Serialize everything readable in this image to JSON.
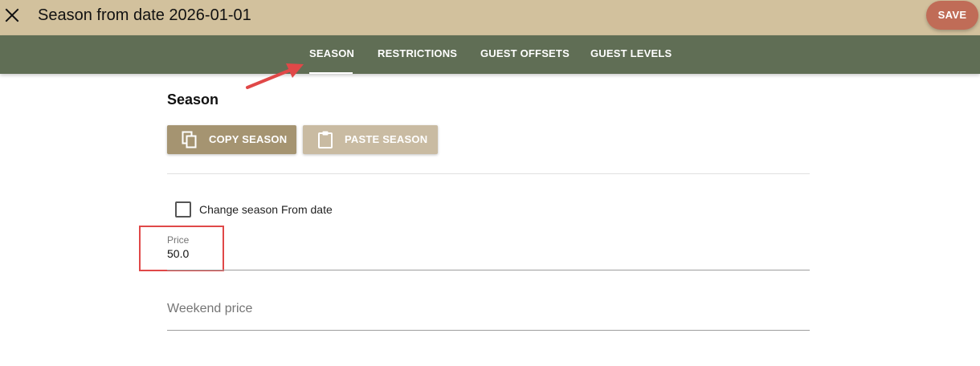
{
  "header": {
    "title": "Season from date 2026-01-01",
    "save_label": "SAVE"
  },
  "tabs": [
    {
      "label": "SEASON",
      "active": true
    },
    {
      "label": "RESTRICTIONS",
      "active": false
    },
    {
      "label": "GUEST OFFSETS",
      "active": false
    },
    {
      "label": "GUEST LEVELS",
      "active": false
    }
  ],
  "season": {
    "title": "Season",
    "copy_label": "COPY SEASON",
    "paste_label": "PASTE SEASON",
    "change_from_date_label": "Change season From date",
    "change_from_date_checked": false,
    "price": {
      "label": "Price",
      "value": "50.0"
    },
    "weekend_price": {
      "placeholder": "Weekend price",
      "value": ""
    }
  },
  "icons": {
    "close": "close-icon",
    "copy": "copy-icon",
    "paste": "clipboard-icon"
  },
  "colors": {
    "header_bg": "#d2c19d",
    "tabbar_bg": "#606e55",
    "save_bg": "#c06c57",
    "copy_bg": "#a59471",
    "paste_bg": "#c9bba2",
    "annotation_red": "#e04848"
  }
}
